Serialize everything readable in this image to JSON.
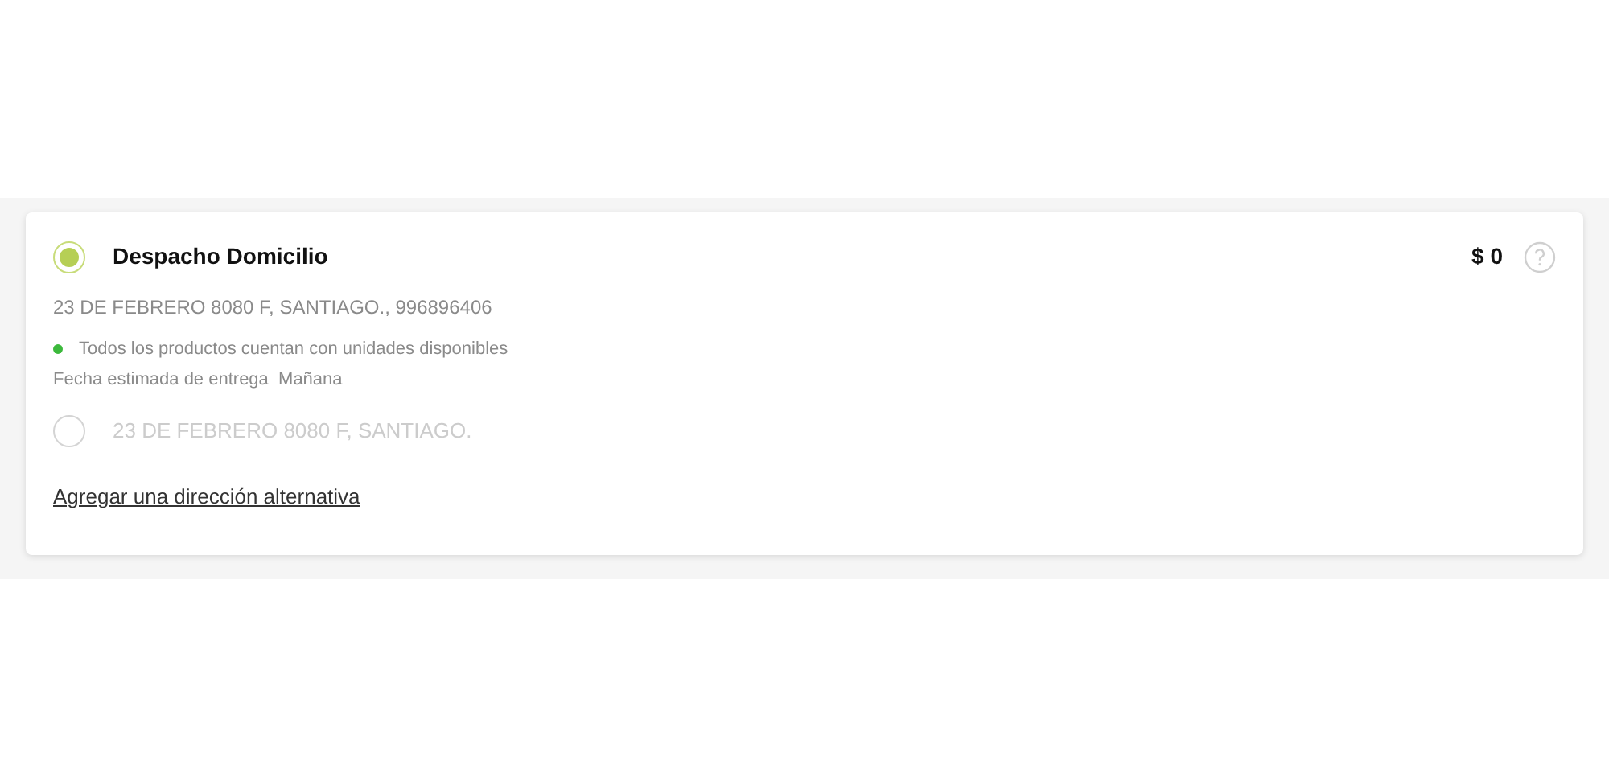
{
  "shipping_option": {
    "title": "Despacho Domicilio",
    "price": "$ 0",
    "selected": true,
    "address": "23 DE FEBRERO 8080 F, SANTIAGO., 996896406",
    "availability": {
      "text": "Todos los productos cuentan con unidades disponibles",
      "color": "#3cb93c"
    },
    "delivery_estimate": "Fecha estimada de entrega  Mañana"
  },
  "addresses": [
    {
      "label": "23 DE FEBRERO 8080 F, SANTIAGO.",
      "selected": false
    }
  ],
  "add_address_link": "Agregar una dirección alternativa"
}
